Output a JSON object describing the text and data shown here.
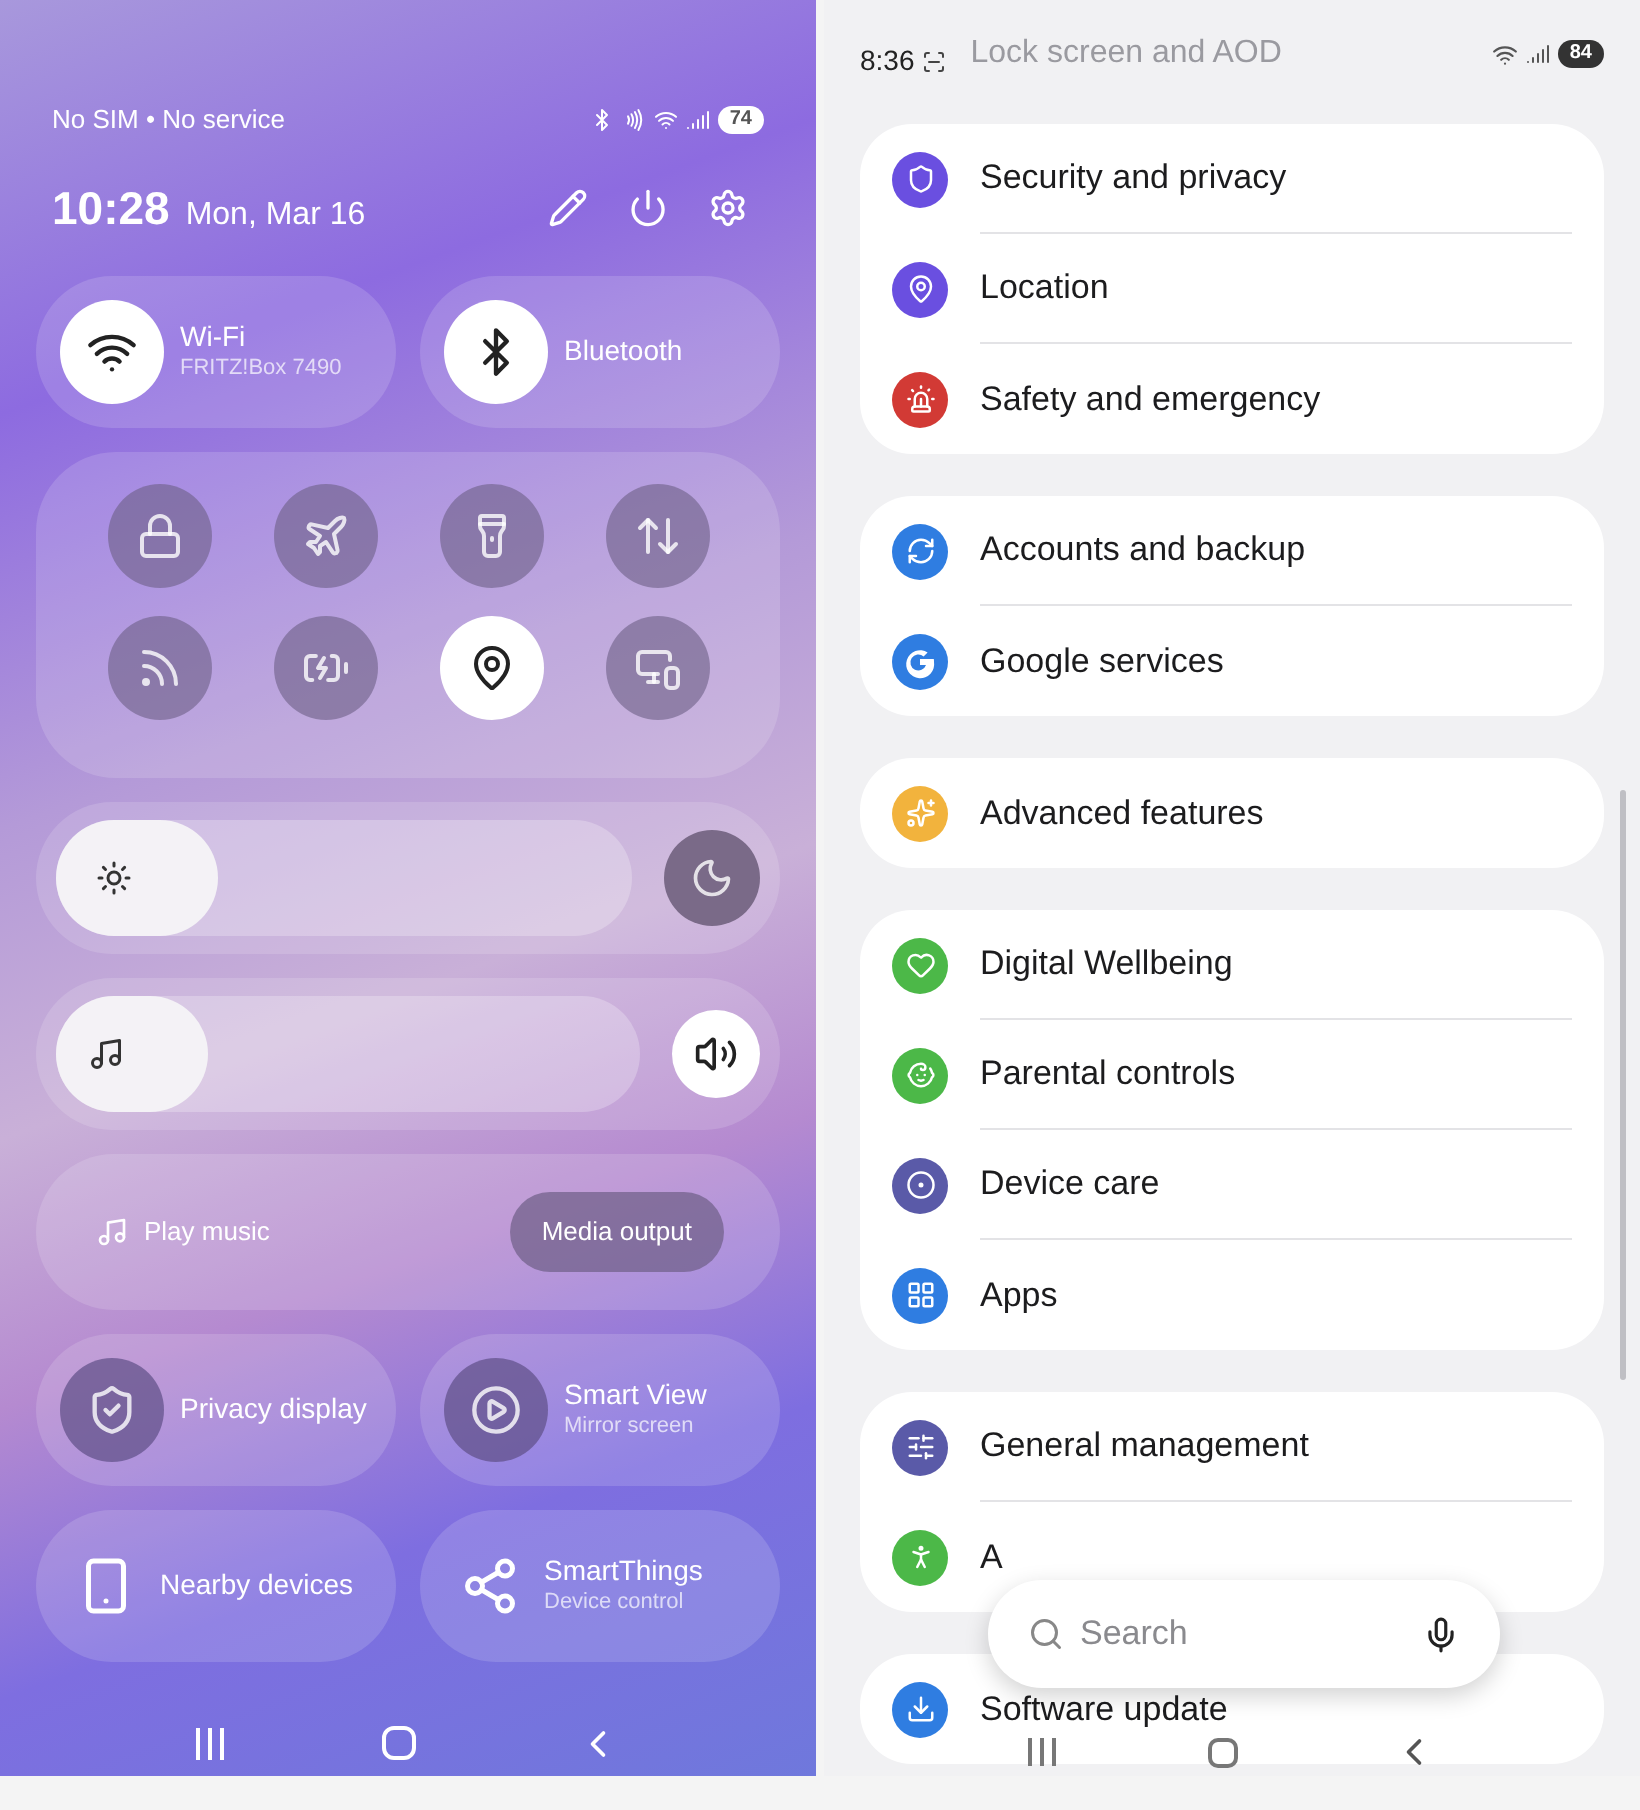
{
  "quick_panel": {
    "status": {
      "carrier": "No SIM • No service",
      "battery": "74"
    },
    "header": {
      "time": "10:28",
      "date": "Mon, Mar 16"
    },
    "main_tiles": [
      {
        "kind": "wifi",
        "title": "Wi-Fi",
        "subtitle": "FRITZ!Box 7490",
        "on": true
      },
      {
        "kind": "bluetooth",
        "title": "Bluetooth",
        "on": true
      }
    ],
    "quick_toggles": [
      {
        "kind": "lock",
        "on": false
      },
      {
        "kind": "airplane",
        "on": false
      },
      {
        "kind": "flashlight",
        "on": false
      },
      {
        "kind": "data",
        "on": false
      },
      {
        "kind": "cast",
        "on": false
      },
      {
        "kind": "battery",
        "on": false
      },
      {
        "kind": "location",
        "on": true
      },
      {
        "kind": "screens",
        "on": false
      }
    ],
    "brightness": {
      "level": 0.28,
      "dark_mode": false
    },
    "volume": {
      "level": 0.26
    },
    "media": {
      "label": "Play music",
      "button": "Media output"
    },
    "tiles": [
      {
        "kind": "privacy",
        "title": "Privacy display",
        "on": false
      },
      {
        "kind": "smartview",
        "title": "Smart View",
        "subtitle": "Mirror screen",
        "on": false
      },
      {
        "kind": "nearby",
        "title": "Nearby devices"
      },
      {
        "kind": "smartthings",
        "title": "SmartThings",
        "subtitle": "Device control"
      }
    ]
  },
  "settings": {
    "status": {
      "time": "8:36",
      "battery": "84"
    },
    "faded_item": "Lock screen and AOD",
    "groups": [
      [
        {
          "kind": "shield",
          "label": "Security and privacy",
          "color": "#6a4fe0"
        },
        {
          "kind": "pin",
          "label": "Location",
          "color": "#6a4fe0"
        },
        {
          "kind": "siren",
          "label": "Safety and emergency",
          "color": "#d23a35"
        }
      ],
      [
        {
          "kind": "sync",
          "label": "Accounts and backup",
          "color": "#2f7de1"
        },
        {
          "kind": "google",
          "label": "Google services",
          "color": "#2f7de1"
        }
      ],
      [
        {
          "kind": "gear",
          "label": "Advanced features",
          "color": "#f2b33d"
        }
      ],
      [
        {
          "kind": "heart",
          "label": "Digital Wellbeing",
          "color": "#4cb848"
        },
        {
          "kind": "child",
          "label": "Parental controls",
          "color": "#4cb848"
        },
        {
          "kind": "device",
          "label": "Device care",
          "color": "#5a5aa8"
        },
        {
          "kind": "apps",
          "label": "Apps",
          "color": "#2f7de1"
        }
      ],
      [
        {
          "kind": "sliders",
          "label": "General management",
          "color": "#5a5aa8"
        },
        {
          "kind": "person",
          "label": "A",
          "color": "#4cb848"
        }
      ],
      [
        {
          "kind": "download",
          "label": "Software update",
          "color": "#2f7de1"
        }
      ]
    ],
    "search": {
      "placeholder": "Search"
    }
  }
}
